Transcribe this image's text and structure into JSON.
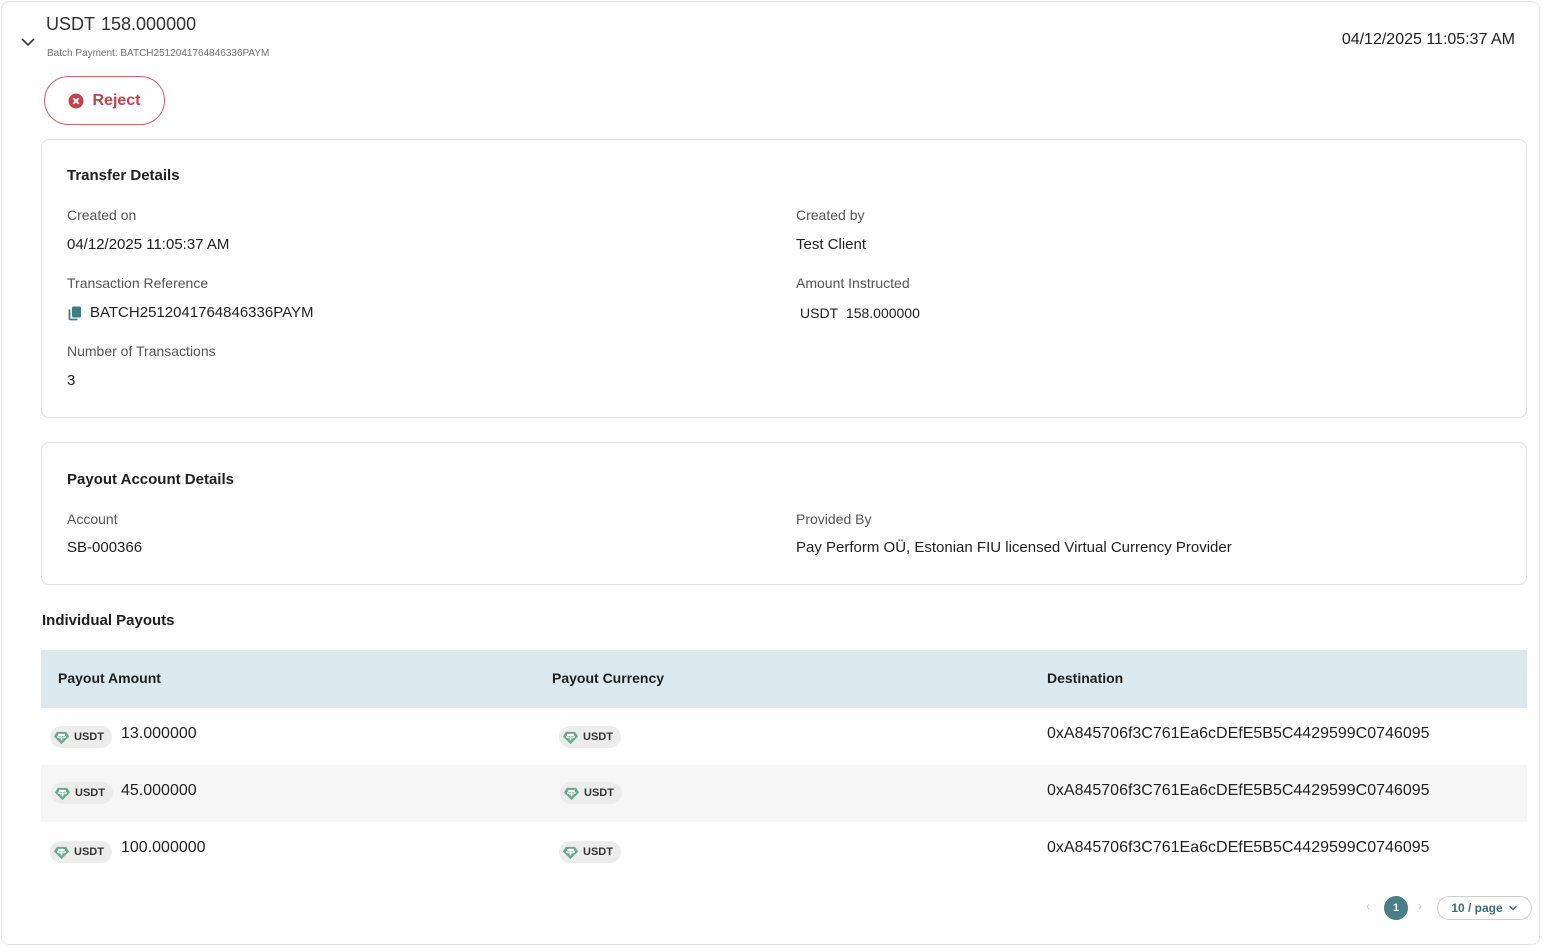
{
  "header": {
    "currency": "USDT",
    "amount": "158.000000",
    "subtitle": "Batch Payment: BATCH2512041764846336PAYM",
    "date": "04/12/2025 11:05:37 AM",
    "expand_icon": "chevron-down-icon"
  },
  "actions": {
    "reject_label": "Reject",
    "reject_icon": "x-circle-icon",
    "reject_color": "#c2434d"
  },
  "transfer_details": {
    "title": "Transfer Details",
    "created_on_label": "Created on",
    "created_on": "04/12/2025 11:05:37 AM",
    "created_by_label": "Created by",
    "created_by": "Test Client",
    "reference_label": "Transaction Reference",
    "reference": "BATCH2512041764846336PAYM",
    "reference_icon": "copy-icon",
    "amount_label": "Amount Instructed",
    "amount_currency": "USDT",
    "amount_value": "158.000000",
    "count_label": "Number of Transactions",
    "count": "3"
  },
  "payout_account": {
    "title": "Payout Account Details",
    "account_label": "Account",
    "account": "SB-000366",
    "provider_label": "Provided By",
    "provider": "Pay Perform OÜ, Estonian FIU licensed Virtual Currency Provider"
  },
  "payouts": {
    "title": "Individual Payouts",
    "columns": [
      "Payout Amount",
      "Payout Currency",
      "Destination"
    ],
    "rows": [
      {
        "currency": "USDT",
        "amount": "13.000000",
        "payout_currency": "USDT",
        "destination": "0xA845706f3C761Ea6cDEfE5B5C4429599C0746095"
      },
      {
        "currency": "USDT",
        "amount": "45.000000",
        "payout_currency": "USDT",
        "destination": "0xA845706f3C761Ea6cDEfE5B5C4429599C0746095"
      },
      {
        "currency": "USDT",
        "amount": "100.000000",
        "payout_currency": "USDT",
        "destination": "0xA845706f3C761Ea6cDEfE5B5C4429599C0746095"
      }
    ],
    "header_bg": "#d9e9ee",
    "tether_color": "#6aa88f"
  },
  "pagination": {
    "current_page": "1",
    "page_size": "10 / page",
    "accent": "#4a7f86"
  }
}
